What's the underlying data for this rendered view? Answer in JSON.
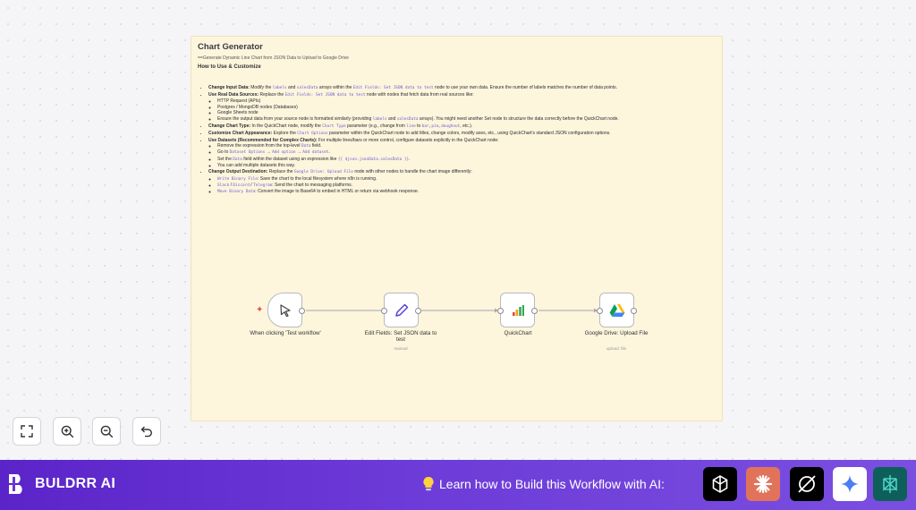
{
  "note": {
    "title": "Chart Generator",
    "subtitle": "==Generate Dynamic Line Chart from JSON Data to Upload to Google Drive",
    "heading": "How to Use & Customize",
    "items": [
      {
        "label": "Change Input Data:",
        "parts": [
          "Modify the ",
          "labels",
          " and ",
          "salesData",
          " arrays within the ",
          "Edit Fields: Set JSON data to test",
          " node to use your own data. Ensure the number of labels matches the number of data points."
        ],
        "sub": []
      },
      {
        "label": "Use Real Data Sources:",
        "parts": [
          "Replace the ",
          "Edit Fields: Set JSON data to test",
          " node with nodes that fetch data from real sources like:"
        ],
        "sub": [
          [
            "HTTP Request (APIs)"
          ],
          [
            "Postgres / MongoDB nodes (Databases)"
          ],
          [
            "Google Sheets node"
          ],
          [
            "Ensure the output data from your source node is formatted similarly (providing ",
            "labels",
            " and ",
            "salesData",
            " arrays). You might need another Set node to structure the data correctly before the QuickChart node."
          ]
        ]
      },
      {
        "label": "Change Chart Type:",
        "parts": [
          "In the QuickChart node, modify the ",
          "Chart Type",
          " parameter (e.g., change from ",
          "line",
          " to ",
          "bar",
          ", ",
          "pie",
          ", ",
          "doughnut",
          ", etc.)."
        ],
        "sub": []
      },
      {
        "label": "Customize Chart Appearance:",
        "parts": [
          "Explore the ",
          "Chart Options",
          " parameter within the QuickChart node to add titles, change colors, modify axes, etc., using QuickChart's standard JSON configuration options."
        ],
        "sub": []
      },
      {
        "label": "Use Datasets (Recommended for Complex Charts):",
        "parts": [
          "For multiple lines/bars or more control, configure datasets explicitly in the QuickChart node:"
        ],
        "sub": [
          [
            "Remove the expression from the top-level ",
            "Data",
            " field."
          ],
          [
            "Go to ",
            "Dataset Options",
            " → ",
            "Add option",
            " → ",
            "Add dataset",
            "."
          ],
          [
            "Set the ",
            "Data",
            " field within the dataset using an expression like ",
            "{{ $json.jsonData.salesData }}",
            "."
          ],
          [
            "You can add multiple datasets this way."
          ]
        ]
      },
      {
        "label": "Change Output Destination:",
        "parts": [
          "Replace the ",
          "Google Drive: Upload File",
          " node with other nodes to handle the chart image differently:"
        ],
        "sub": [
          [
            "Write Binary File",
            ": Save the chart to the local filesystem where n8n is running."
          ],
          [
            "Slack",
            " / ",
            "Discord",
            " / ",
            "Telegram",
            ": Send the chart to messaging platforms."
          ],
          [
            "Move Binary Data",
            ": Convert the image to Base64 to embed in HTML or return via webhook response."
          ]
        ]
      }
    ]
  },
  "nodes": {
    "trigger": {
      "label": "When clicking 'Test workflow'"
    },
    "edit": {
      "label": "Edit Fields: Set JSON data to test",
      "sub": "manual"
    },
    "quickchart": {
      "label": "QuickChart"
    },
    "drive": {
      "label": "Google Drive: Upload File",
      "sub": "upload: file"
    }
  },
  "controls": [
    "fit-view-icon",
    "zoom-in-icon",
    "zoom-out-icon",
    "undo-icon"
  ],
  "footer": {
    "brand": "BULDRR AI",
    "learn": "Learn how to Build this Workflow with AI:",
    "ai_apps": [
      "chatgpt-icon",
      "claude-icon",
      "grok-icon",
      "gemini-icon",
      "perplexity-icon"
    ],
    "colors": {
      "bar": "#6a35d6",
      "claude": "#e0735a",
      "gemini": "#ffffff",
      "perplexity": "#0e5f5a"
    }
  }
}
